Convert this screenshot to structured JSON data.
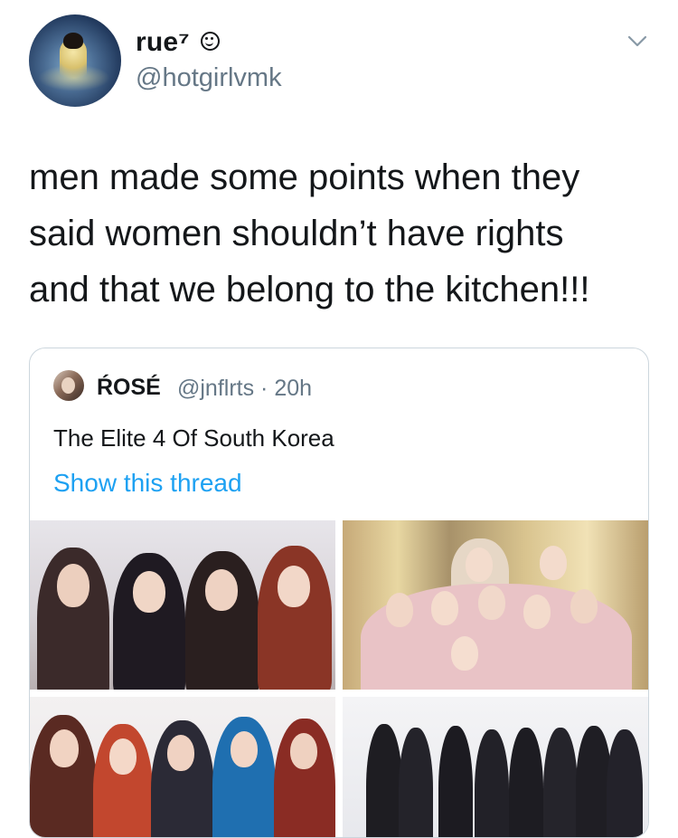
{
  "author": {
    "display_name": "rue⁷",
    "handle": "@hotgirlvmk",
    "avatar_icon": "user-avatar",
    "verified_badge_icon": "smiley-face-icon"
  },
  "menu_icon": "chevron-down-icon",
  "tweet": {
    "lines": [
      "men made some points when they",
      "said women shouldn’t have rights",
      "and that we belong to the kitchen!!!"
    ]
  },
  "quoted_tweet": {
    "display_name": "ŔOSÉ",
    "handle_time": "@jnflrts · 20h",
    "text": "The Elite 4 Of South Korea",
    "show_thread": "Show this thread",
    "photo_count": 4
  },
  "colors": {
    "text": "#14171a",
    "secondary": "#657786",
    "link": "#1da1f2",
    "border": "#ccd6dd"
  }
}
